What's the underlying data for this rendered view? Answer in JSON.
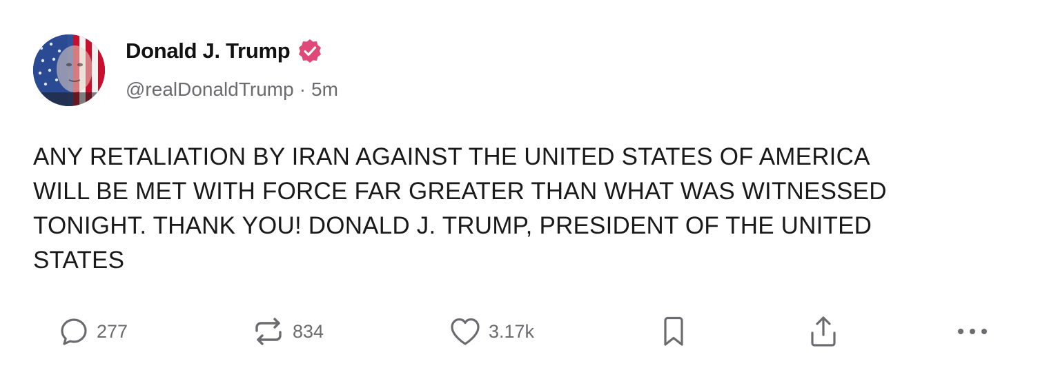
{
  "post": {
    "author": {
      "display_name": "Donald J. Trump",
      "handle": "@realDonaldTrump",
      "verified": true,
      "verified_color": "#e0487a",
      "avatar_icon": "flag-portrait-avatar"
    },
    "separator": "·",
    "time_ago": "5m",
    "text": "ANY RETALIATION BY IRAN AGAINST THE UNITED STATES OF AMERICA\nWILL BE MET WITH FORCE FAR GREATER THAN WHAT WAS WITNESSED\nTONIGHT. THANK YOU! DONALD J. TRUMP, PRESIDENT OF THE UNITED\nSTATES"
  },
  "actions": {
    "reply": {
      "icon": "reply-icon",
      "count": "277"
    },
    "repost": {
      "icon": "repost-icon",
      "count": "834"
    },
    "like": {
      "icon": "heart-icon",
      "count": "3.17k"
    },
    "bookmark": {
      "icon": "bookmark-icon"
    },
    "share": {
      "icon": "share-icon"
    },
    "more": {
      "icon": "more-icon"
    }
  },
  "colors": {
    "text": "#111111",
    "muted": "#6b6b70",
    "icon": "#6b6b70",
    "accent": "#e0487a"
  }
}
